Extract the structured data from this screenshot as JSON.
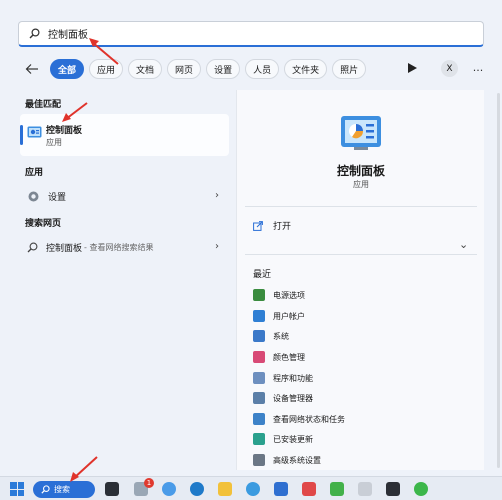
{
  "search": {
    "query": "控制面板"
  },
  "filters": {
    "items": [
      "全部",
      "应用",
      "文档",
      "网页",
      "设置",
      "人员",
      "文件夹",
      "照片"
    ],
    "active_index": 0,
    "x_label": "X",
    "more_label": "..."
  },
  "left": {
    "best_match_title": "最佳匹配",
    "best_match": {
      "name": "控制面板",
      "type": "应用"
    },
    "apps_title": "应用",
    "apps": [
      {
        "label": "设置"
      }
    ],
    "web_title": "搜索网页",
    "web": [
      {
        "label": "控制面板",
        "sub": "- 查看网络搜索结果"
      }
    ]
  },
  "right": {
    "name": "控制面板",
    "type": "应用",
    "open_label": "打开",
    "recent_title": "最近",
    "recent": [
      {
        "label": "电源选项",
        "icon": "power-icon",
        "color": "#3a8c3f"
      },
      {
        "label": "用户帐户",
        "icon": "users-icon",
        "color": "#2f7fd4"
      },
      {
        "label": "系统",
        "icon": "system-icon",
        "color": "#3b79c9"
      },
      {
        "label": "颜色管理",
        "icon": "color-icon",
        "color": "#d84a76"
      },
      {
        "label": "程序和功能",
        "icon": "programs-icon",
        "color": "#6d8fbf"
      },
      {
        "label": "设备管理器",
        "icon": "device-manager-icon",
        "color": "#5b7fa8"
      },
      {
        "label": "查看网络状态和任务",
        "icon": "network-icon",
        "color": "#3d82c8"
      },
      {
        "label": "已安装更新",
        "icon": "updates-icon",
        "color": "#2aa08d"
      },
      {
        "label": "高级系统设置",
        "icon": "advanced-system-icon",
        "color": "#6b7785"
      }
    ]
  },
  "taskbar": {
    "search_label": "搜索",
    "badge_count": "1"
  },
  "colors": {
    "accent": "#2a6fd6",
    "annotation": "#e0332b"
  }
}
